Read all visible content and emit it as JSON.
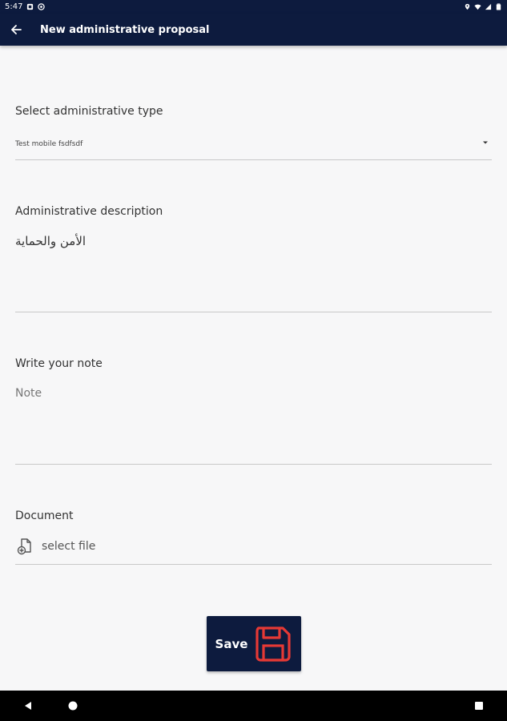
{
  "status_bar": {
    "time": "5:47"
  },
  "app_bar": {
    "title": "New administrative proposal"
  },
  "form": {
    "type_label": "Select administrative type",
    "type_value": "Test mobile fsdfsdf",
    "description_label": "Administrative description",
    "description_value": "الأمن والحماية",
    "note_label": "Write your note",
    "note_placeholder": "Note",
    "document_label": "Document",
    "select_file_label": "select file"
  },
  "save_button": {
    "label": "Save"
  },
  "colors": {
    "primary": "#0d1b3e",
    "accent": "#e53935",
    "background": "#f7f7f8"
  },
  "icons": [
    "back-arrow-icon",
    "dropdown-arrow-icon",
    "add-file-icon",
    "floppy-disk-icon",
    "nav-back-icon",
    "nav-home-icon",
    "nav-recents-icon"
  ]
}
